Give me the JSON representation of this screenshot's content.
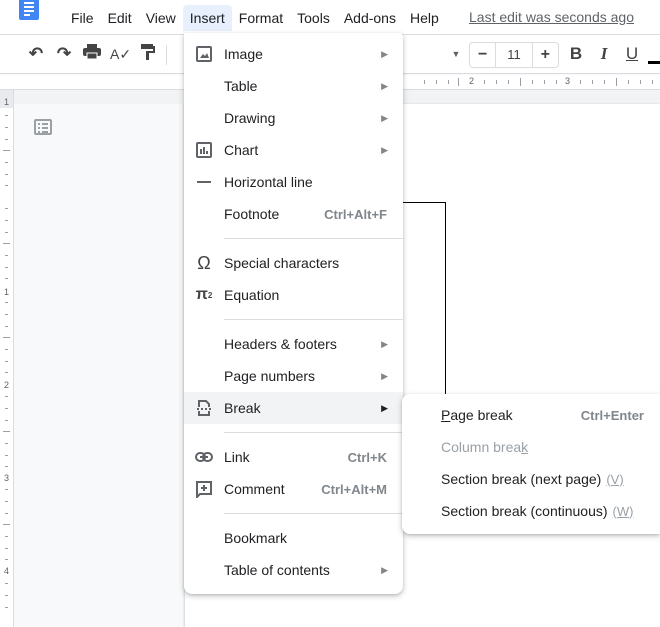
{
  "menubar": {
    "items": [
      "File",
      "Edit",
      "View",
      "Insert",
      "Format",
      "Tools",
      "Add-ons",
      "Help"
    ],
    "active": "Insert",
    "last_edit": "Last edit was seconds ago"
  },
  "toolbar": {
    "font_size": "11",
    "decrease": "−",
    "increase": "+",
    "bold": "B",
    "italic": "I",
    "underline": "U"
  },
  "ruler": {
    "h_labels": [
      "2",
      "3"
    ],
    "v_labels": [
      "1",
      "1",
      "2",
      "3",
      "4"
    ]
  },
  "insert_menu": {
    "items": [
      {
        "label": "Image",
        "icon": "image-icon",
        "submenu": true
      },
      {
        "label": "Table",
        "submenu": true
      },
      {
        "label": "Drawing",
        "submenu": true
      },
      {
        "label": "Chart",
        "icon": "chart-icon",
        "submenu": true
      },
      {
        "label": "Horizontal line",
        "icon": "horizontal-line-icon"
      },
      {
        "label": "Footnote",
        "shortcut": "Ctrl+Alt+F"
      },
      {
        "label": "Special characters",
        "icon": "omega-icon"
      },
      {
        "label": "Equation",
        "icon": "pi-icon"
      },
      {
        "label": "Headers & footers",
        "submenu": true
      },
      {
        "label": "Page numbers",
        "submenu": true
      },
      {
        "label": "Break",
        "icon": "page-break-icon",
        "submenu": true,
        "highlighted": true
      },
      {
        "label": "Link",
        "icon": "link-icon",
        "shortcut": "Ctrl+K"
      },
      {
        "label": "Comment",
        "icon": "comment-icon",
        "shortcut": "Ctrl+Alt+M"
      },
      {
        "label": "Bookmark"
      },
      {
        "label": "Table of contents",
        "submenu": true
      }
    ]
  },
  "break_submenu": {
    "items": [
      {
        "label_ul": "P",
        "label_rest": "age break",
        "shortcut": "Ctrl+Enter"
      },
      {
        "label_pre": "Column brea",
        "label_ul": "k",
        "disabled": true
      },
      {
        "label": "Section break (next page)",
        "accel": "(V)"
      },
      {
        "label": "Section break (continuous)",
        "accel": "(W)"
      }
    ]
  }
}
